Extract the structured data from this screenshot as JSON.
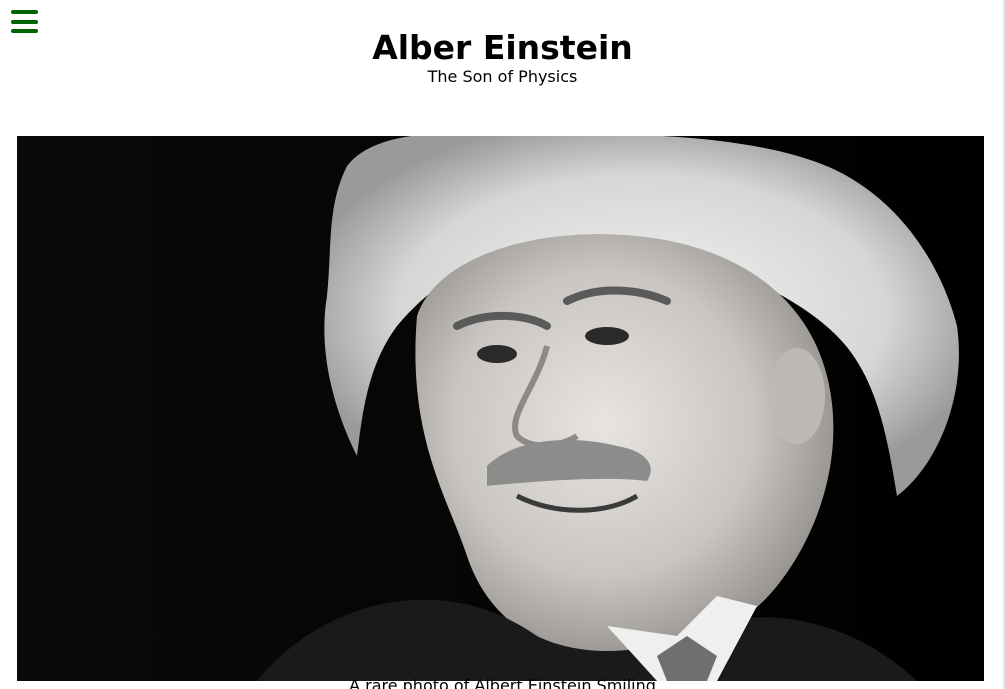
{
  "nav": {
    "menu_icon": "hamburger-icon",
    "menu_color": "#006400"
  },
  "header": {
    "title": "Alber Einstein",
    "subtitle": "The Son of Physics"
  },
  "figure": {
    "image_alt": "A rare photo of Albert Einstein Smiling",
    "caption": "A rare photo of Albert Einstein Smiling"
  }
}
